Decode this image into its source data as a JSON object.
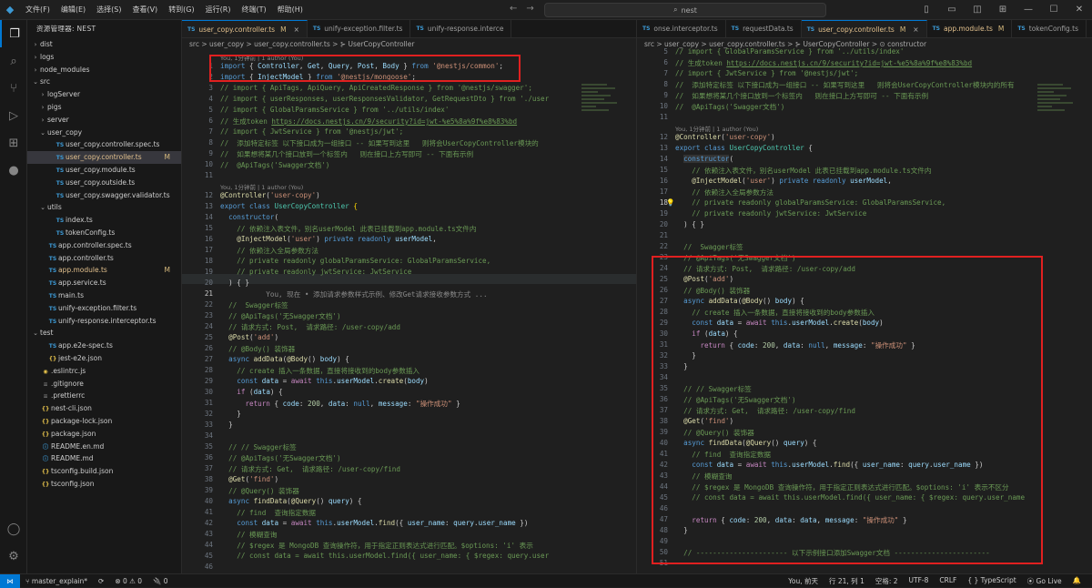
{
  "titlebar": {
    "menu": [
      "文件(F)",
      "编辑(E)",
      "选择(S)",
      "查看(V)",
      "转到(G)",
      "运行(R)",
      "终端(T)",
      "帮助(H)"
    ],
    "search": "nest"
  },
  "explorer": {
    "title": "资源管理器: NEST",
    "items": [
      {
        "label": "dist",
        "level": 1,
        "type": "folder",
        "open": false
      },
      {
        "label": "logs",
        "level": 1,
        "type": "folder",
        "open": false
      },
      {
        "label": "node_modules",
        "level": 1,
        "type": "folder",
        "open": false
      },
      {
        "label": "src",
        "level": 1,
        "type": "folder",
        "open": true
      },
      {
        "label": "logServer",
        "level": 2,
        "type": "folder",
        "open": false
      },
      {
        "label": "pigs",
        "level": 2,
        "type": "folder",
        "open": false
      },
      {
        "label": "server",
        "level": 2,
        "type": "folder",
        "open": false
      },
      {
        "label": "user_copy",
        "level": 2,
        "type": "folder",
        "open": true
      },
      {
        "label": "user_copy.controller.spec.ts",
        "level": 3,
        "type": "ts"
      },
      {
        "label": "user_copy.controller.ts",
        "level": 3,
        "type": "ts",
        "selected": true,
        "mod": "M"
      },
      {
        "label": "user_copy.module.ts",
        "level": 3,
        "type": "ts"
      },
      {
        "label": "user_copy.outside.ts",
        "level": 3,
        "type": "ts"
      },
      {
        "label": "user_copy.swagger.validator.ts",
        "level": 3,
        "type": "ts"
      },
      {
        "label": "utils",
        "level": 2,
        "type": "folder",
        "open": true
      },
      {
        "label": "index.ts",
        "level": 3,
        "type": "ts"
      },
      {
        "label": "tokenConfig.ts",
        "level": 3,
        "type": "ts"
      },
      {
        "label": "app.controller.spec.ts",
        "level": 2,
        "type": "ts"
      },
      {
        "label": "app.controller.ts",
        "level": 2,
        "type": "ts"
      },
      {
        "label": "app.module.ts",
        "level": 2,
        "type": "ts",
        "mod": "M"
      },
      {
        "label": "app.service.ts",
        "level": 2,
        "type": "ts"
      },
      {
        "label": "main.ts",
        "level": 2,
        "type": "ts"
      },
      {
        "label": "unify-exception.filter.ts",
        "level": 2,
        "type": "ts"
      },
      {
        "label": "unify-response.interceptor.ts",
        "level": 2,
        "type": "ts"
      },
      {
        "label": "test",
        "level": 1,
        "type": "folder",
        "open": true
      },
      {
        "label": "app.e2e-spec.ts",
        "level": 2,
        "type": "ts"
      },
      {
        "label": "jest-e2e.json",
        "level": 2,
        "type": "json"
      },
      {
        "label": ".eslintrc.js",
        "level": 1,
        "type": "js"
      },
      {
        "label": ".gitignore",
        "level": 1,
        "type": "dot"
      },
      {
        "label": ".prettierrc",
        "level": 1,
        "type": "dot"
      },
      {
        "label": "nest-cli.json",
        "level": 1,
        "type": "json"
      },
      {
        "label": "package-lock.json",
        "level": 1,
        "type": "json"
      },
      {
        "label": "package.json",
        "level": 1,
        "type": "json"
      },
      {
        "label": "README.en.md",
        "level": 1,
        "type": "md"
      },
      {
        "label": "README.md",
        "level": 1,
        "type": "md"
      },
      {
        "label": "tsconfig.build.json",
        "level": 1,
        "type": "json"
      },
      {
        "label": "tsconfig.json",
        "level": 1,
        "type": "json"
      }
    ]
  },
  "editor_left": {
    "tabs": [
      {
        "label": "user_copy.controller.ts",
        "active": true,
        "mod": "M"
      },
      {
        "label": "unify-exception.filter.ts"
      },
      {
        "label": "unify-response.interce"
      }
    ],
    "breadcrumb": "src > user_copy > user_copy.controller.ts > ⊱ UserCopyController",
    "lens_top": "You, 1分钟前 | 1 author (You)",
    "lens_class": "You, 1分钟前 | 1 author (You)",
    "blame_21": "You, 现在 • 添加请求参数样式示例、修改Get请求接收参数方式 ..."
  },
  "editor_right": {
    "tabs": [
      {
        "label": "onse.interceptor.ts"
      },
      {
        "label": "requestData.ts"
      },
      {
        "label": "user_copy.controller.ts",
        "active": true,
        "mod": "M"
      },
      {
        "label": "app.module.ts",
        "mod": "M"
      },
      {
        "label": "tokenConfig.ts"
      }
    ],
    "breadcrumb": "src > user_copy > user_copy.controller.ts > ⊱ UserCopyController > ⊙ constructor",
    "lens_class": "You, 1分钟前 | 1 author (You)"
  },
  "status": {
    "branch": "master_explain*",
    "sync": "⟳",
    "errors": "⊗ 0 ⚠ 0",
    "ports": "🔌 0",
    "blame": "You, 前天",
    "cursor": "行 21, 列 1",
    "spaces": "空格: 2",
    "encoding": "UTF-8",
    "eol": "CRLF",
    "language": "{ } TypeScript",
    "golive": "Go Live"
  }
}
